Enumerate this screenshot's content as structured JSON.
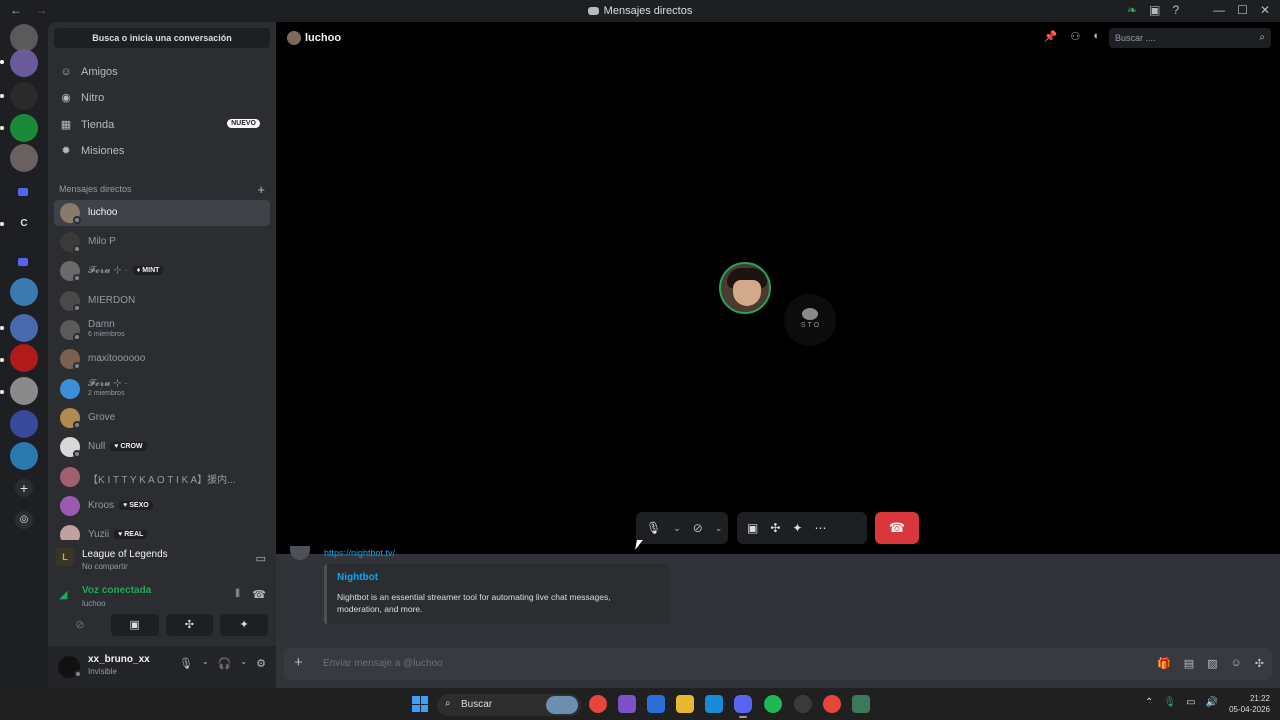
{
  "window": {
    "title": "Mensajes directos",
    "nav_back": "←",
    "nav_forward": "→",
    "controls": [
      "—",
      "☐",
      "✕"
    ]
  },
  "dm_column": {
    "search_label": "Busca o inicia una conversación",
    "nav": [
      {
        "label": "Amigos",
        "icon": "friends-icon"
      },
      {
        "label": "Nitro",
        "icon": "nitro-icon"
      },
      {
        "label": "Tienda",
        "icon": "shop-icon",
        "badge": "NUEVO"
      },
      {
        "label": "Misiones",
        "icon": "quests-icon"
      }
    ],
    "dm_header": "Mensajes directos",
    "dms": [
      {
        "name": "luchoo",
        "sub": "",
        "tag": "",
        "color": "#8a7a6a",
        "active": true
      },
      {
        "name": "Milo P",
        "sub": "",
        "tag": "",
        "color": "#3a3a3a"
      },
      {
        "name": "𝓕𝓮𝓻𝓾 ⊹ ·",
        "sub": "",
        "tag": "MINT",
        "color": "#6a6a6a"
      },
      {
        "name": "MIERDON",
        "sub": "",
        "tag": "",
        "color": "#4a4a4a"
      },
      {
        "name": "Damn",
        "sub": "6 miembros",
        "tag": "",
        "color": "#5a5a5a"
      },
      {
        "name": "maxitoooooo",
        "sub": "",
        "tag": "",
        "color": "#7a6050"
      },
      {
        "name": "𝓕𝓮𝓻𝓾 ⊹ ·",
        "sub": "2 miembros",
        "tag": "",
        "color": "#3a8fd8"
      },
      {
        "name": "Grove",
        "sub": "",
        "tag": "",
        "color": "#b08a50"
      },
      {
        "name": "Null",
        "sub": "",
        "tag": "CROW",
        "color": "#d8d8d8"
      },
      {
        "name": "【K I T T Y K A O T I K A】援内...",
        "sub": "",
        "tag": "",
        "color": "#a06070"
      },
      {
        "name": "Kroos",
        "sub": "",
        "tag": "SEXO",
        "color": "#9a5ab0"
      },
      {
        "name": "Yuzii",
        "sub": "",
        "tag": "REAL",
        "color": "#c0a0a0"
      }
    ]
  },
  "voice_panel": {
    "game_title": "League of Legends",
    "game_sub": "No compartir",
    "status": "Voz conectada",
    "channel": "luchoo"
  },
  "user_panel": {
    "username": "xx_bruno_xx",
    "status": "Invisible"
  },
  "main": {
    "recipient": "luchoo",
    "search_placeholder": "Buscar ....",
    "participant2_text": "S T O",
    "link_text": "https://nightbot.tv/",
    "embed_title": "Nightbot",
    "embed_desc": "Nightbot is an essential streamer tool for automating live chat messages, moderation, and more.",
    "composer_placeholder": "Enviar mensaje a @luchoo"
  },
  "taskbar": {
    "search_label": "Buscar",
    "time": "21:22",
    "date": "05-04-2026"
  },
  "colors": {
    "accent": "#5865f2",
    "online": "#23a55a",
    "danger": "#da373c",
    "link": "#00a8fc"
  }
}
